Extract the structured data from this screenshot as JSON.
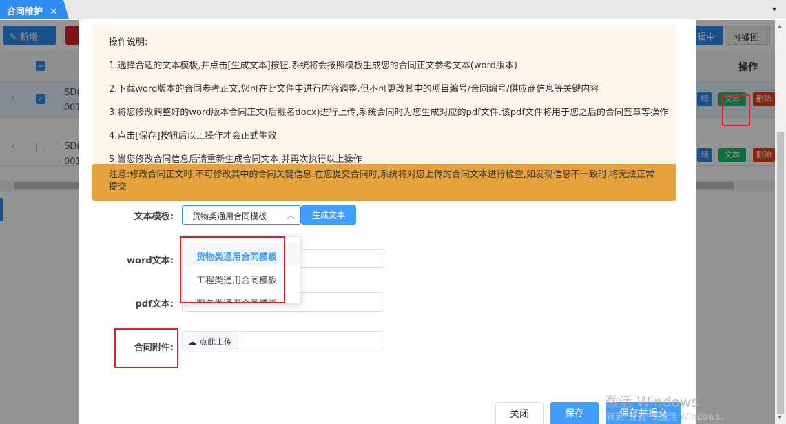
{
  "tabs": {
    "active_label": "合同维护",
    "close_glyph": "✕",
    "menu_glyph": "▾"
  },
  "background": {
    "toolbar": {
      "new_label": "新增",
      "right_btn1": "辑中",
      "right_btn2": "可撤回"
    },
    "table": {
      "op_header": "操作"
    },
    "rows": [
      {
        "code_line1": "SD(",
        "code_line2": "001",
        "edit": "辑",
        "text": "文本",
        "del": "删除"
      },
      {
        "code_line1": "SD(",
        "code_line2": "001",
        "edit": "辑",
        "text": "文本",
        "del": "删除"
      }
    ]
  },
  "notice": {
    "title": "操作说明:",
    "lines": [
      "1.选择合适的文本模板,并点击[生成文本]按钮.系统将会按照模板生成您的合同正文参考文本(word版本)",
      "2.下载word版本的合同参考正文,您可在此文件中进行内容调整.但不可更改其中的项目编号/合同编号/供应商信息等关键内容",
      "3.将您修改调整好的word版本合同正文(后缀名docx)进行上传,系统会同时为您生成对应的pdf文件.该pdf文件将用于您之后的合同签章等操作",
      "4.点击[保存]按钮后以上操作才会正式生效",
      "5.当您修改合同信息后请重新生成合同文本,并再次执行以上操作"
    ],
    "warning": "注意:修改合同正文时,不可修改其中的合同关键信息.在您提交合同时,系统将对您上传的合同文本进行检查,如发现信息不一致时,将无法正常提交"
  },
  "form": {
    "template_label": "文本模板:",
    "template_value": "货物类通用合同模板",
    "generate_label": "生成文本",
    "word_label": "word文本:",
    "pdf_label": "pdf文本:",
    "attachment_label": "合同附件:",
    "upload_label": "点此上传",
    "dropdown_options": [
      "货物类通用合同模板",
      "工程类通用合同模板",
      "服务类通用合同模板"
    ]
  },
  "footer": {
    "close_label": "关闭",
    "save_label": "保存",
    "submit_label": "保存并提交"
  },
  "watermark": {
    "line1": "激活 Windows",
    "line2": "转到\"设置\"以激活 Windows。"
  },
  "colors": {
    "primary": "#409eff",
    "warning": "#e6a23c",
    "notice_bg": "#fdf6ec",
    "highlight": "#e02020"
  }
}
